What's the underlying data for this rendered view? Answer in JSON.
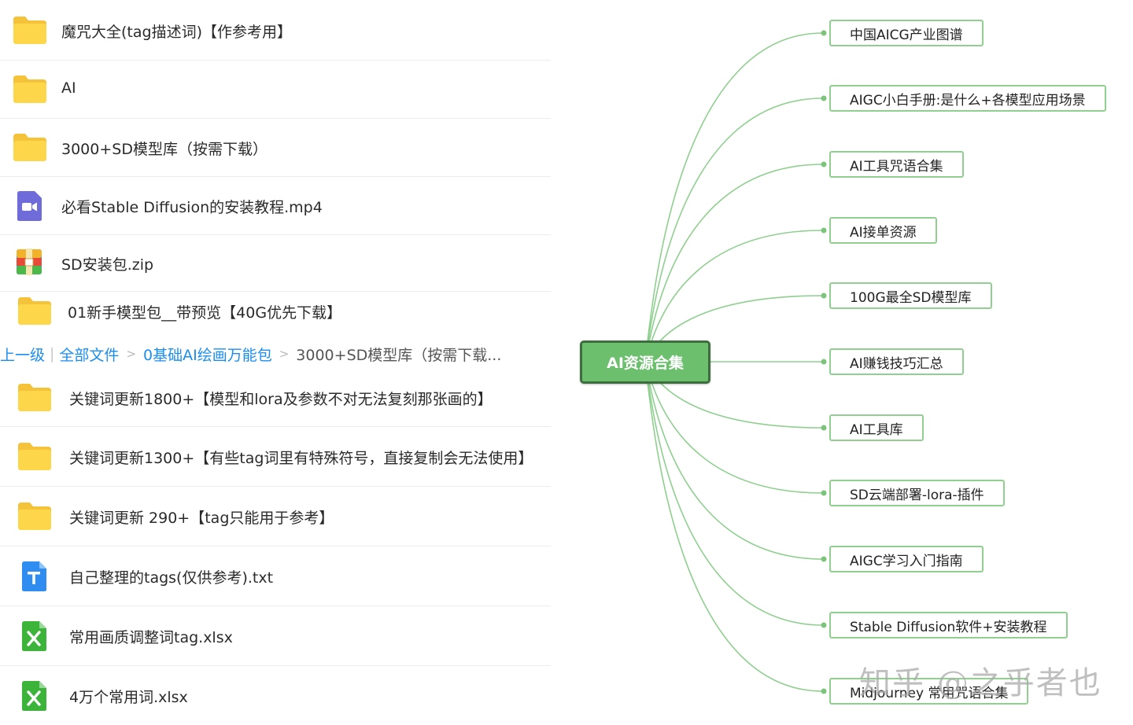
{
  "files_top": [
    {
      "name": "魔咒大全(tag描述词)【作参考用】",
      "icon": "folder-icon"
    },
    {
      "name": "AI",
      "icon": "folder-icon"
    },
    {
      "name": "3000+SD模型库（按需下载）",
      "icon": "folder-icon"
    },
    {
      "name": "必看Stable Diffusion的安装教程.mp4",
      "icon": "video-file-icon"
    },
    {
      "name": "SD安装包.zip",
      "icon": "zip-archive-icon"
    },
    {
      "name": "01新手模型包__带预览【40G优先下载】",
      "icon": "folder-icon"
    }
  ],
  "breadcrumb": {
    "up": "上一级",
    "separator": "|",
    "all_files": "全部文件",
    "arrow": ">",
    "level1": "0基础AI绘画万能包",
    "current": "3000+SD模型库（按需下载..."
  },
  "files_bottom": [
    {
      "name": "关键词更新1800+【模型和lora及参数不对无法复刻那张画的】",
      "icon": "folder-icon"
    },
    {
      "name": "关键词更新1300+【有些tag词里有特殊符号，直接复制会无法使用】",
      "icon": "folder-icon"
    },
    {
      "name": "关键词更新 290+【tag只能用于参考】",
      "icon": "folder-icon"
    },
    {
      "name": "自己整理的tags(仅供参考).txt",
      "icon": "text-file-icon"
    },
    {
      "name": "常用画质调整词tag.xlsx",
      "icon": "excel-file-icon"
    },
    {
      "name": "4万个常用词.xlsx",
      "icon": "excel-file-icon"
    }
  ],
  "mindmap": {
    "center": "AI资源合集",
    "branches": [
      "中国AICG产业图谱",
      "AIGC小白手册:是什么+各模型应用场景",
      "AI工具咒语合集",
      "AI接单资源",
      "100G最全SD模型库",
      "AI赚钱技巧汇总",
      "AI工具库",
      "SD云端部署-lora-插件",
      "AIGC学习入门指南",
      "Stable Diffusion软件+安装教程",
      "Midjourney 常用咒语合集"
    ]
  },
  "watermark": "知乎 @之乎者也",
  "colors": {
    "folder": "#fdd64a",
    "folder_back": "#f4c33a",
    "video": "#6f6bd9",
    "txt": "#2f8cf0",
    "excel": "#3cb43a",
    "link": "#1a8ef0",
    "mind_center": "#6bbf6d",
    "mind_line": "#8fcf8f"
  }
}
